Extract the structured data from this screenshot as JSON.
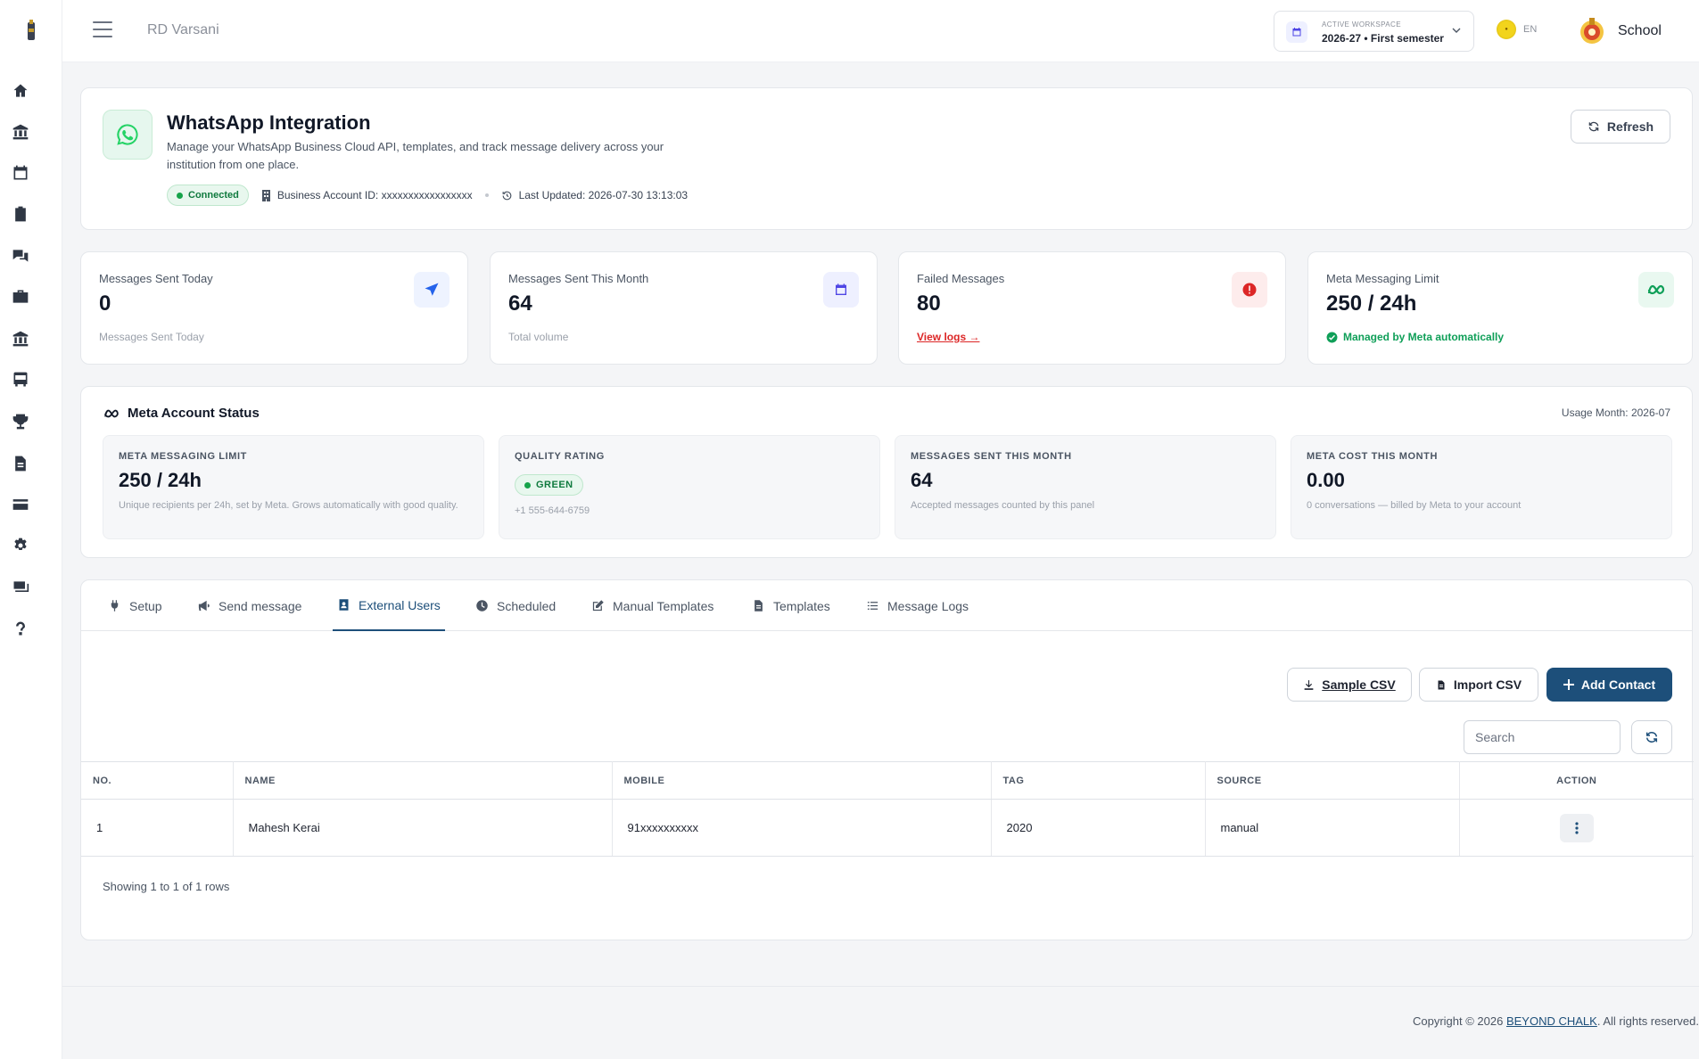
{
  "topbar": {
    "tenant": "RD Varsani",
    "workspace_label": "ACTIVE WORKSPACE",
    "workspace_value": "2026-27 • First semester",
    "lang": "EN",
    "school_label": "School"
  },
  "hero": {
    "title": "WhatsApp Integration",
    "description": "Manage your WhatsApp Business Cloud API, templates, and track message delivery across your institution from one place.",
    "status": "Connected",
    "account_id": "Business Account ID: xxxxxxxxxxxxxxxxx",
    "last_updated": "Last Updated: 2026-07-30 13:13:03",
    "refresh_label": "Refresh"
  },
  "stats": [
    {
      "label": "Messages Sent Today",
      "value": "0",
      "sub": "Messages Sent Today",
      "icon": "send-icon",
      "accent": "#2563eb"
    },
    {
      "label": "Messages Sent This Month",
      "value": "64",
      "sub": "Total volume",
      "icon": "calendar-icon",
      "accent": "#4f46e5"
    },
    {
      "label": "Failed Messages",
      "value": "80",
      "sub": "View logs →",
      "icon": "alert-icon",
      "accent": "#dc2626"
    },
    {
      "label": "Meta Messaging Limit",
      "value": "250 / 24h",
      "sub": "Managed by Meta automatically",
      "icon": "meta-icon",
      "accent": "#0f9f58"
    }
  ],
  "meta_status": {
    "title": "Meta Account Status",
    "usage_month": "Usage Month: 2026-07",
    "boxes": [
      {
        "label": "META MESSAGING LIMIT",
        "value": "250 / 24h",
        "sub": "Unique recipients per 24h, set by Meta. Grows automatically with good quality."
      },
      {
        "label": "QUALITY RATING",
        "value": "GREEN",
        "sub": "+1 555-644-6759"
      },
      {
        "label": "MESSAGES SENT THIS MONTH",
        "value": "64",
        "sub": "Accepted messages counted by this panel"
      },
      {
        "label": "META COST THIS MONTH",
        "value": "0.00",
        "sub": "0 conversations — billed by Meta to your account"
      }
    ]
  },
  "tabs": [
    {
      "label": "Setup",
      "icon": "plug-icon"
    },
    {
      "label": "Send message",
      "icon": "megaphone-icon"
    },
    {
      "label": "External Users",
      "icon": "contact-book-icon"
    },
    {
      "label": "Scheduled",
      "icon": "clock-icon"
    },
    {
      "label": "Manual Templates",
      "icon": "edit-icon"
    },
    {
      "label": "Templates",
      "icon": "file-icon"
    },
    {
      "label": "Message Logs",
      "icon": "list-icon"
    }
  ],
  "active_tab": "External Users",
  "actions": {
    "sample_csv": "Sample CSV",
    "import_csv": "Import CSV",
    "add_contact": "Add Contact",
    "search_placeholder": "Search"
  },
  "table": {
    "columns": [
      "NO.",
      "NAME",
      "MOBILE",
      "TAG",
      "SOURCE",
      "ACTION"
    ],
    "rows": [
      {
        "no": "1",
        "name": "Mahesh Kerai",
        "mobile": "91xxxxxxxxxx",
        "tag": "2020",
        "source": "manual"
      }
    ],
    "summary": "Showing 1 to 1 of 1 rows"
  },
  "footer": {
    "prefix": "Copyright © 2026 ",
    "brand": "BEYOND CHALK",
    "suffix": ". All rights reserved."
  },
  "colors": {
    "primary": "#1d4f7a",
    "success": "#16a34a",
    "danger": "#dc2626",
    "whatsapp": "#25d366"
  }
}
